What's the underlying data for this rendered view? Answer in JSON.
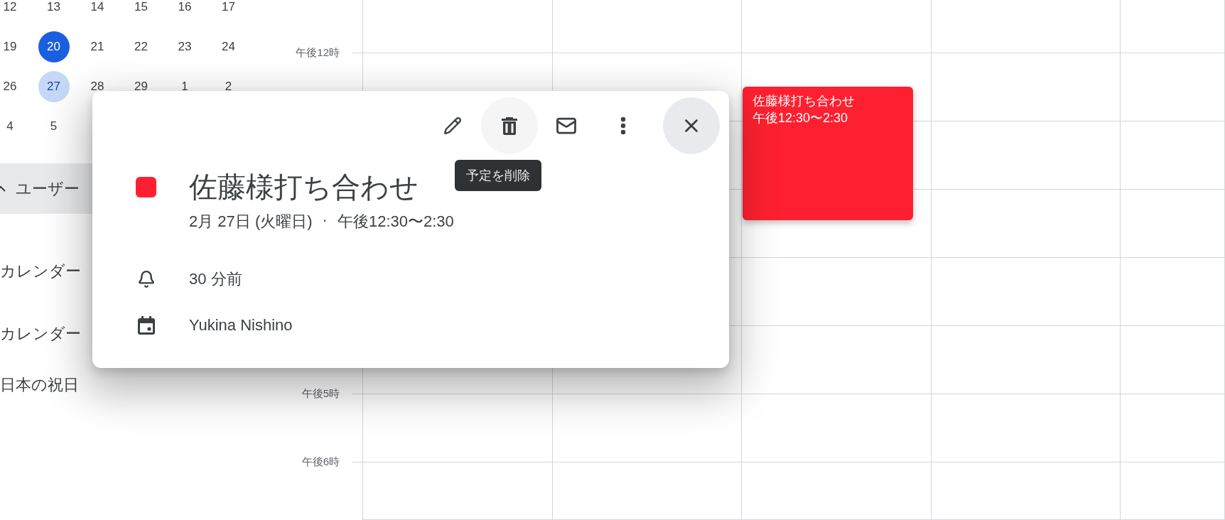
{
  "mini_calendar": {
    "weeks": [
      [
        {
          "day": "12",
          "today": false,
          "selected": false
        },
        {
          "day": "13",
          "today": false,
          "selected": false
        },
        {
          "day": "14",
          "today": false,
          "selected": false
        },
        {
          "day": "15",
          "today": false,
          "selected": false
        },
        {
          "day": "16",
          "today": false,
          "selected": false
        },
        {
          "day": "17",
          "today": false,
          "selected": false
        }
      ],
      [
        {
          "day": "19",
          "today": false,
          "selected": false
        },
        {
          "day": "20",
          "today": true,
          "selected": false
        },
        {
          "day": "21",
          "today": false,
          "selected": false
        },
        {
          "day": "22",
          "today": false,
          "selected": false
        },
        {
          "day": "23",
          "today": false,
          "selected": false
        },
        {
          "day": "24",
          "today": false,
          "selected": false
        }
      ],
      [
        {
          "day": "26",
          "today": false,
          "selected": false
        },
        {
          "day": "27",
          "today": false,
          "selected": true
        },
        {
          "day": "28",
          "today": false,
          "selected": false
        },
        {
          "day": "29",
          "today": false,
          "selected": false
        },
        {
          "day": "1",
          "today": false,
          "selected": false
        },
        {
          "day": "2",
          "today": false,
          "selected": false
        }
      ],
      [
        {
          "day": "4",
          "today": false,
          "selected": false
        },
        {
          "day": "5",
          "today": false,
          "selected": false
        }
      ]
    ]
  },
  "sidebar": {
    "items": [
      {
        "kind": "header",
        "label": "ユーザー",
        "selected": true
      },
      {
        "kind": "calendar",
        "label": "カレンダー",
        "selected": false
      },
      {
        "kind": "calendar",
        "label": "カレンダー",
        "selected": false
      },
      {
        "kind": "calendar",
        "label": "日本の祝日",
        "selected": false
      }
    ]
  },
  "time_labels": [
    "午後12時",
    "午後5時",
    "午後6時"
  ],
  "event": {
    "title": "佐藤様打ち合わせ",
    "time": "午後12:30〜2:30",
    "color": "#fe2030"
  },
  "popup": {
    "tooltip": "予定を削除",
    "title": "佐藤様打ち合わせ",
    "color": "#fe2030",
    "date": "2月 27日 (火曜日)",
    "separator": "·",
    "time": "午後12:30〜2:30",
    "reminder": "30 分前",
    "calendar": "Yukina Nishino"
  }
}
